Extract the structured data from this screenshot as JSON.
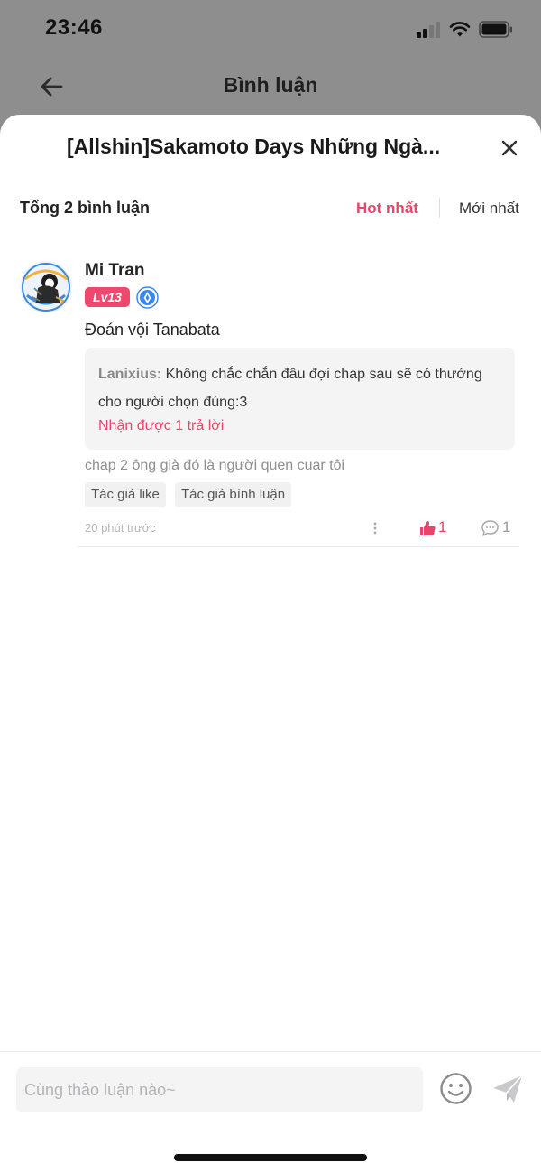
{
  "status_bar": {
    "time": "23:46"
  },
  "background_header": {
    "title": "Bình luận"
  },
  "sheet": {
    "title": "[Allshin]Sakamoto Days Những Ngà...",
    "count_label": "Tổng 2 bình luận",
    "sort": {
      "hot_label": "Hot nhất",
      "new_label": "Mới nhất",
      "active": "Hot nhất"
    }
  },
  "comment": {
    "author": "Mi Tran",
    "level": "Lv13",
    "text": "Đoán vội Tanabata",
    "reply": {
      "author": "Lanixius",
      "separator": ":",
      "text": " Không chắc chắn đâu đợi chap sau sẽ có thưởng cho người chọn đúng:3",
      "more_label": "Nhận được 1 trả lời"
    },
    "reply_snippet": "chap 2 ông già đó là người quen cuar tôi",
    "tags": [
      "Tác giả like",
      "Tác giả bình luận"
    ],
    "timestamp": "20 phút trước",
    "likes": "1",
    "replies": "1"
  },
  "composer": {
    "placeholder": "Cùng thảo luận nào~"
  },
  "colors": {
    "accent": "#e8456b",
    "level_badge": "#f0476f",
    "verified": "#3c86f0"
  },
  "icons": [
    "back-arrow-icon",
    "close-icon",
    "verified-icon",
    "more-icon",
    "like-icon",
    "reply-icon",
    "emoji-icon",
    "send-icon"
  ]
}
